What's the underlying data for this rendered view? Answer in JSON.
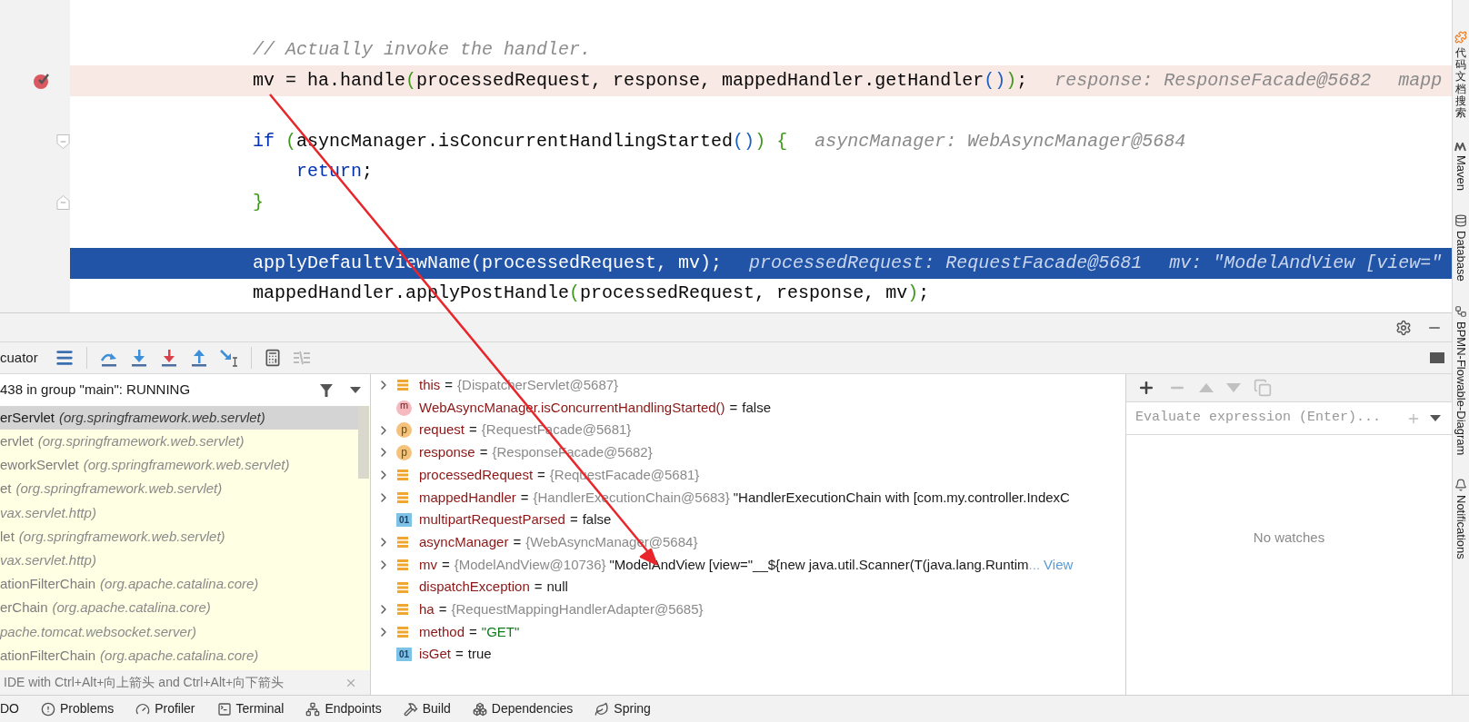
{
  "editor": {
    "lines": [
      {
        "kind": "blank"
      },
      {
        "kind": "code",
        "breakpoint": false,
        "execution": false,
        "tokens": [
          {
            "text": "// Actually invoke the handler.",
            "kind": "comment"
          }
        ]
      },
      {
        "kind": "code",
        "breakpoint": true,
        "execution": false,
        "tokens": [
          {
            "text": "mv = ha.handle",
            "kind": "plain"
          },
          {
            "text": "(",
            "kind": "paren-green"
          },
          {
            "text": "processedRequest, response, mappedHandler.getHandler",
            "kind": "plain"
          },
          {
            "text": "()",
            "kind": "paren-blue"
          },
          {
            "text": ")",
            "kind": "paren-green"
          },
          {
            "text": ";",
            "kind": "plain"
          }
        ],
        "hints": [
          "response: ResponseFacade@5682",
          "mapp"
        ]
      },
      {
        "kind": "blank"
      },
      {
        "kind": "fold-start",
        "breakpoint": false,
        "execution": false,
        "tokens": [
          {
            "text": "if ",
            "kind": "keyword"
          },
          {
            "text": "(",
            "kind": "paren-green"
          },
          {
            "text": "asyncManager.isConcurrentHandlingStarted",
            "kind": "plain"
          },
          {
            "text": "()",
            "kind": "paren-blue"
          },
          {
            "text": ") {",
            "kind": "paren-green"
          }
        ],
        "hints": [
          "asyncManager: WebAsyncManager@5684"
        ]
      },
      {
        "kind": "code",
        "breakpoint": false,
        "execution": false,
        "tokens": [
          {
            "text": "    return",
            "kind": "keyword"
          },
          {
            "text": ";",
            "kind": "plain"
          }
        ]
      },
      {
        "kind": "fold-end",
        "breakpoint": false,
        "execution": false,
        "tokens": [
          {
            "text": "}",
            "kind": "paren-green"
          }
        ]
      },
      {
        "kind": "blank"
      },
      {
        "kind": "code",
        "breakpoint": false,
        "execution": true,
        "tokens": [
          {
            "text": "applyDefaultViewName(processedRequest, mv);",
            "kind": "plain"
          }
        ],
        "hints": [
          "processedRequest: RequestFacade@5681",
          "mv: \"ModelAndView [view=\""
        ]
      },
      {
        "kind": "code",
        "breakpoint": false,
        "execution": false,
        "tokens": [
          {
            "text": "mappedHandler.applyPostHandle",
            "kind": "plain"
          },
          {
            "text": "(",
            "kind": "paren-green"
          },
          {
            "text": "processedRequest, response, mv",
            "kind": "plain"
          },
          {
            "text": ")",
            "kind": "paren-green"
          },
          {
            "text": ";",
            "kind": "plain"
          }
        ]
      }
    ]
  },
  "debug_toolbar": {
    "label": "cuator",
    "buttons": [
      {
        "kind": "frames-menu"
      },
      {
        "kind": "separator"
      },
      {
        "kind": "step-over"
      },
      {
        "kind": "step-into"
      },
      {
        "kind": "force-step-into"
      },
      {
        "kind": "step-out"
      },
      {
        "kind": "run-to-cursor"
      },
      {
        "kind": "separator"
      },
      {
        "kind": "evaluate"
      },
      {
        "kind": "trace"
      }
    ]
  },
  "frames": {
    "thread": "438 in group \"main\": RUNNING",
    "items": [
      {
        "method": "erServlet",
        "package": "(org.springframework.web.servlet)",
        "selected": true
      },
      {
        "method": "ervlet",
        "package": "(org.springframework.web.servlet)",
        "selected": false
      },
      {
        "method": "eworkServlet",
        "package": "(org.springframework.web.servlet)",
        "selected": false
      },
      {
        "method": "et",
        "package": "(org.springframework.web.servlet)",
        "selected": false
      },
      {
        "package": "vax.servlet.http)",
        "selected": false
      },
      {
        "method": "let",
        "package": "(org.springframework.web.servlet)",
        "selected": false
      },
      {
        "package": "vax.servlet.http)",
        "selected": false
      },
      {
        "method": "ationFilterChain",
        "package": "(org.apache.catalina.core)",
        "selected": false
      },
      {
        "method": "erChain",
        "package": "(org.apache.catalina.core)",
        "selected": false
      },
      {
        "package": "pache.tomcat.websocket.server)",
        "selected": false
      },
      {
        "method": "ationFilterChain",
        "package": "(org.apache.catalina.core)",
        "selected": false
      }
    ],
    "hint": "IDE with Ctrl+Alt+向上箭头 and Ctrl+Alt+向下箭头"
  },
  "variables": [
    {
      "expandable": true,
      "kind": "field",
      "name": "this",
      "operator": "=",
      "type": "{DispatcherServlet@5687}"
    },
    {
      "expandable": false,
      "kind": "method",
      "badge": "m",
      "name": "WebAsyncManager.isConcurrentHandlingStarted()",
      "operator": "=",
      "value": "false"
    },
    {
      "expandable": true,
      "kind": "param",
      "badge": "p",
      "name": "request",
      "operator": "=",
      "type": "{RequestFacade@5681}"
    },
    {
      "expandable": true,
      "kind": "param",
      "badge": "p",
      "name": "response",
      "operator": "=",
      "type": "{ResponseFacade@5682}"
    },
    {
      "expandable": true,
      "kind": "field",
      "name": "processedRequest",
      "operator": "=",
      "type": "{RequestFacade@5681}"
    },
    {
      "expandable": true,
      "kind": "field",
      "name": "mappedHandler",
      "operator": "=",
      "type": "{HandlerExecutionChain@5683}",
      "value": "\"HandlerExecutionChain with [com.my.controller.IndexC"
    },
    {
      "expandable": false,
      "kind": "primitive",
      "badge": "01",
      "name": "multipartRequestParsed",
      "operator": "=",
      "value": "false"
    },
    {
      "expandable": true,
      "kind": "field",
      "name": "asyncManager",
      "operator": "=",
      "type": "{WebAsyncManager@5684}"
    },
    {
      "expandable": true,
      "kind": "field",
      "name": "mv",
      "operator": "=",
      "type": "{ModelAndView@10736}",
      "value": "\"ModelAndView [view=\"__${new java.util.Scanner(T(java.lang.Runtim",
      "ellipsis": "...",
      "link": "View"
    },
    {
      "expandable": false,
      "kind": "field",
      "name": "dispatchException",
      "operator": "=",
      "value": "null"
    },
    {
      "expandable": true,
      "kind": "field",
      "name": "ha",
      "operator": "=",
      "type": "{RequestMappingHandlerAdapter@5685}"
    },
    {
      "expandable": true,
      "kind": "string-field",
      "name": "method",
      "operator": "=",
      "value": "\"GET\""
    },
    {
      "expandable": false,
      "kind": "primitive",
      "badge": "01",
      "name": "isGet",
      "operator": "=",
      "value": "true"
    }
  ],
  "watches": {
    "toolbar": [
      {
        "kind": "add",
        "disabled": false
      },
      {
        "kind": "remove",
        "disabled": true
      },
      {
        "kind": "up",
        "disabled": true
      },
      {
        "kind": "down",
        "disabled": true
      },
      {
        "kind": "copy",
        "disabled": true
      }
    ],
    "placeholder": "Evaluate expression (Enter)...",
    "empty": "No watches"
  },
  "bottom_bar": [
    {
      "kind": "plain",
      "label": "DO"
    },
    {
      "kind": "problems",
      "label": "Problems"
    },
    {
      "kind": "profiler",
      "label": "Profiler"
    },
    {
      "kind": "terminal",
      "label": "Terminal"
    },
    {
      "kind": "endpoints",
      "label": "Endpoints"
    },
    {
      "kind": "build",
      "label": "Build"
    },
    {
      "kind": "dependencies",
      "label": "Dependencies"
    },
    {
      "kind": "spring",
      "label": "Spring"
    }
  ],
  "right_strip": [
    {
      "kind": "plugin",
      "label": "代码文档搜索",
      "upright": true
    },
    {
      "kind": "maven",
      "label": "Maven",
      "upright": false
    },
    {
      "kind": "database",
      "label": "Database",
      "upright": false
    },
    {
      "kind": "diagram",
      "label": "BPMN-Flowable-Diagram",
      "upright": false
    },
    {
      "kind": "bell",
      "label": "Notifications",
      "upright": false
    }
  ]
}
